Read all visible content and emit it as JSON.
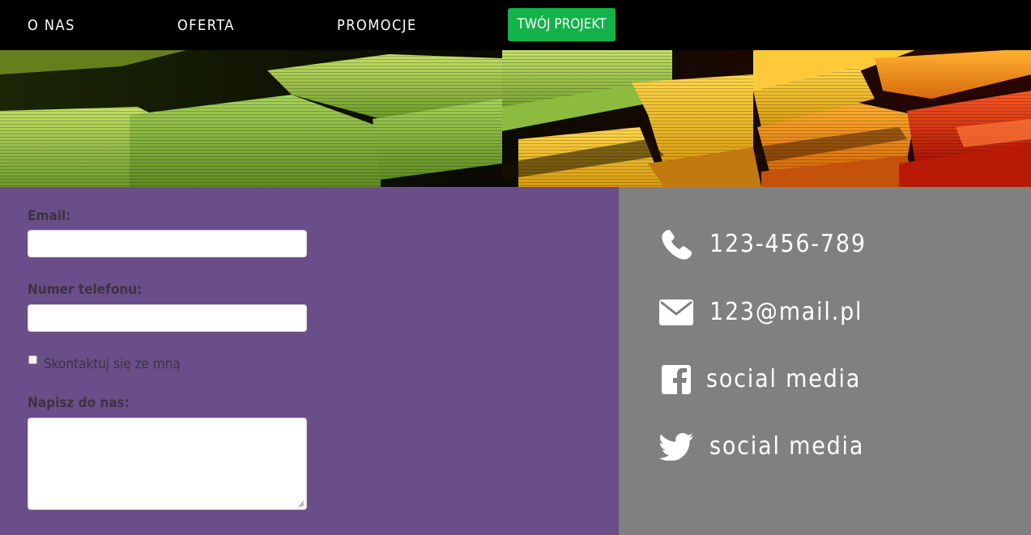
{
  "nav": {
    "items": [
      {
        "label": "O NAS"
      },
      {
        "label": "OFERTA"
      },
      {
        "label": "PROMOCJE"
      }
    ],
    "cta_label": "TWÓJ PROJEKT",
    "cta_color": "#13b24b"
  },
  "form": {
    "email_label": "Email:",
    "email_value": "",
    "phone_label": "Numer telefonu:",
    "phone_value": "",
    "contact_me_label": "Skontaktuj się ze mną",
    "contact_me_checked": false,
    "message_label": "Napisz do nas:",
    "message_value": "",
    "background_color": "#6a4e8a"
  },
  "contact": {
    "background_color": "#808080",
    "items": [
      {
        "icon": "phone-icon",
        "text": "123-456-789"
      },
      {
        "icon": "envelope-icon",
        "text": "123@mail.pl"
      },
      {
        "icon": "facebook-icon",
        "text": "social media"
      },
      {
        "icon": "twitter-icon",
        "text": "social media"
      }
    ]
  },
  "hero": {
    "image": "stacks of colored paper (green, yellow, orange, red)"
  }
}
